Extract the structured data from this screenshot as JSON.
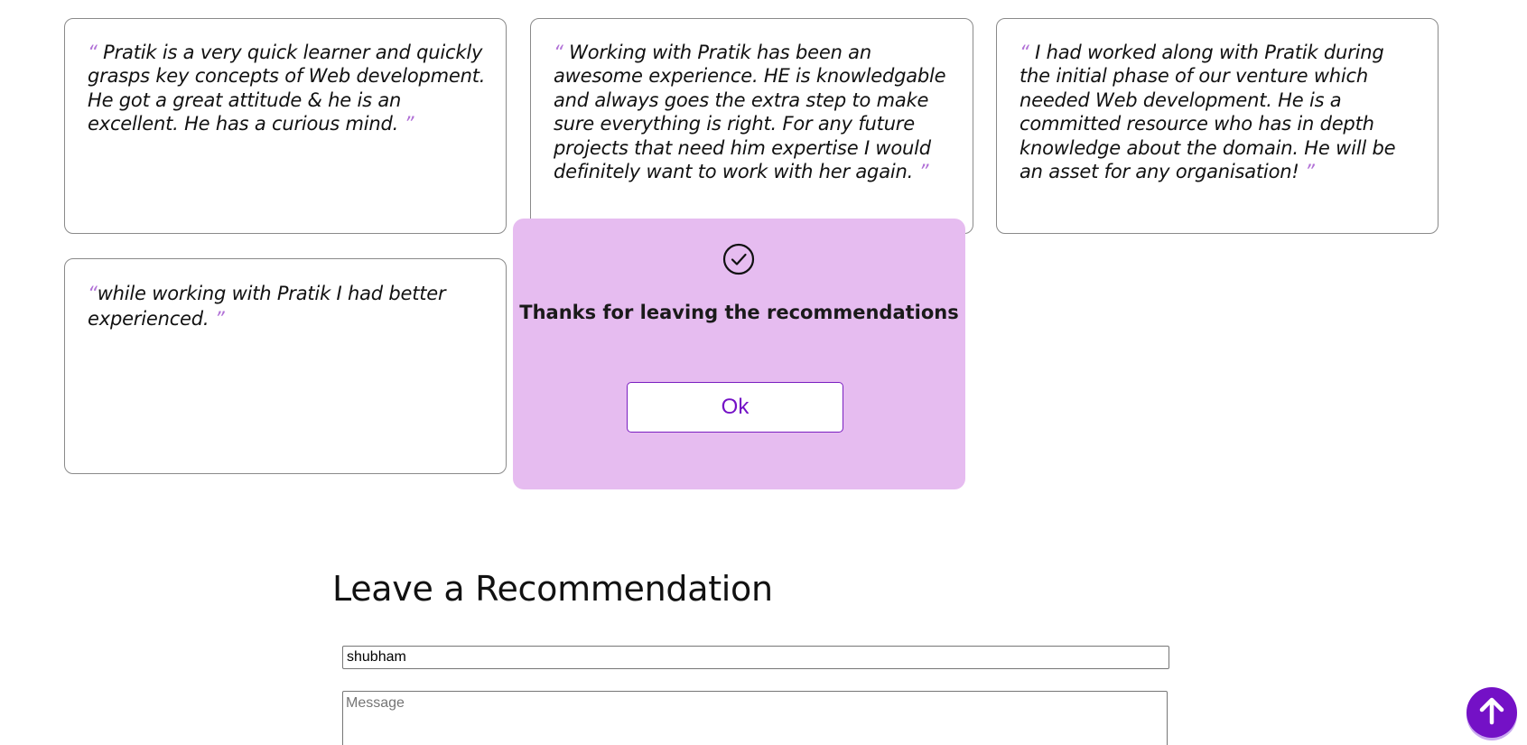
{
  "recommendations": [
    {
      "open_quote": "“",
      "text": " Pratik is a very quick learner and quickly grasps key concepts of Web development. He got a great attitude & he is an excellent. He has a curious mind. ",
      "close_quote": "”"
    },
    {
      "open_quote": "“",
      "text": " Working with Pratik has been an awesome experience. HE is knowledgable and always goes the extra step to make sure everything is right. For any future projects that need him expertise I would definitely want to work with her again. ",
      "close_quote": "”"
    },
    {
      "open_quote": "“",
      "text": " I had worked along with Pratik during the initial phase of our venture which needed Web development. He is a committed resource who has in depth knowledge about the domain. He will be an asset for any organisation! ",
      "close_quote": "”"
    },
    {
      "open_quote": "“",
      "text": "while working with Pratik I had better experienced. ",
      "close_quote": "”"
    }
  ],
  "modal": {
    "icon": "check-circle-icon",
    "message": "Thanks for leaving the recommendations",
    "ok_label": "Ok"
  },
  "form": {
    "title": "Leave a Recommendation",
    "name_value": "shubham",
    "message_placeholder": "Message"
  },
  "scroll_top": {
    "icon": "arrow-up-icon"
  },
  "colors": {
    "accent": "#7411c6",
    "modal_bg": "#e6bcf0",
    "quote_mark": "#b06fd6"
  }
}
